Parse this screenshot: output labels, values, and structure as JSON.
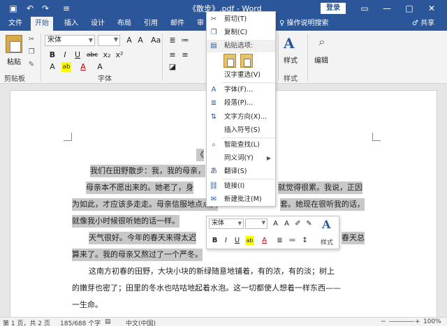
{
  "titlebar": {
    "title": "《散步》.pdf - Word",
    "login": "登录",
    "save_icon": "save-icon",
    "undo_icon": "undo-icon",
    "redo_icon": "redo-icon",
    "customize_icon": "customize-icon",
    "accent": "#2b579a",
    "win_restore": "▭",
    "win_min": "—",
    "win_max": "□",
    "win_close": "✕"
  },
  "tabs": [
    {
      "label": "文件"
    },
    {
      "label": "开始",
      "active": true
    },
    {
      "label": "插入"
    },
    {
      "label": "设计"
    },
    {
      "label": "布局"
    },
    {
      "label": "引用"
    },
    {
      "label": "邮件"
    },
    {
      "label": "审"
    }
  ],
  "tell_me": "♀ 操作说明搜索",
  "share": "♂ 共享",
  "ribbon": {
    "paste_label": "粘贴",
    "clipboard_label": "剪贴板",
    "font_label": "字体",
    "font_name": "宋体",
    "styles_label": "样式",
    "edit_label": "编辑",
    "bold": "B",
    "italic": "I",
    "underline": "U",
    "strike": "abc",
    "sub": "x₂",
    "sup": "x²",
    "font_color": "A",
    "highlight": "ab"
  },
  "document": {
    "lines": [
      "《",
      "我们在田野散步：我，我的母亲，",
      "母亲本不愿出来的。她老了，身",
      "就觉得很累。我说，正因",
      "为如此，才应该多走走。母亲信服地点点头",
      "套。她现在很听我的话，",
      "就像我小时候很听她的话一样。",
      "天气很好。今年的春天来得太迟",
      "春天总",
      "算来了。我的母亲又熬过了一个严冬。",
      "这南方初春的田野，大块小块的新绿随意地铺着，有的浓，有的淡；树上",
      "的嫩芽也密了；田里的冬水也咕咕地起着水泡。这一切都使人想着一样东西——",
      "一生命。"
    ]
  },
  "context_menu": {
    "cut": "剪切(T)",
    "copy": "复制(C)",
    "paste_options": "粘贴选项:",
    "reconvert": "汉字重选(V)",
    "font": "字体(F)...",
    "paragraph": "段落(P)...",
    "text_direction": "文字方向(X)...",
    "insert_symbol": "插入符号(S)",
    "smart_lookup": "智能查找(L)",
    "synonyms": "同义词(Y)",
    "translate": "翻译(S)",
    "link": "链接(I)",
    "new_comment": "新建批注(M)"
  },
  "mini_toolbar": {
    "font_name": "宋体",
    "styles_label": "样式",
    "bold": "B",
    "italic": "I",
    "underline": "U"
  },
  "statusbar": {
    "page": "第 1 页，共 2 页",
    "words": "185/688 个字",
    "lang": "中文(中国)",
    "zoom": "100%"
  }
}
